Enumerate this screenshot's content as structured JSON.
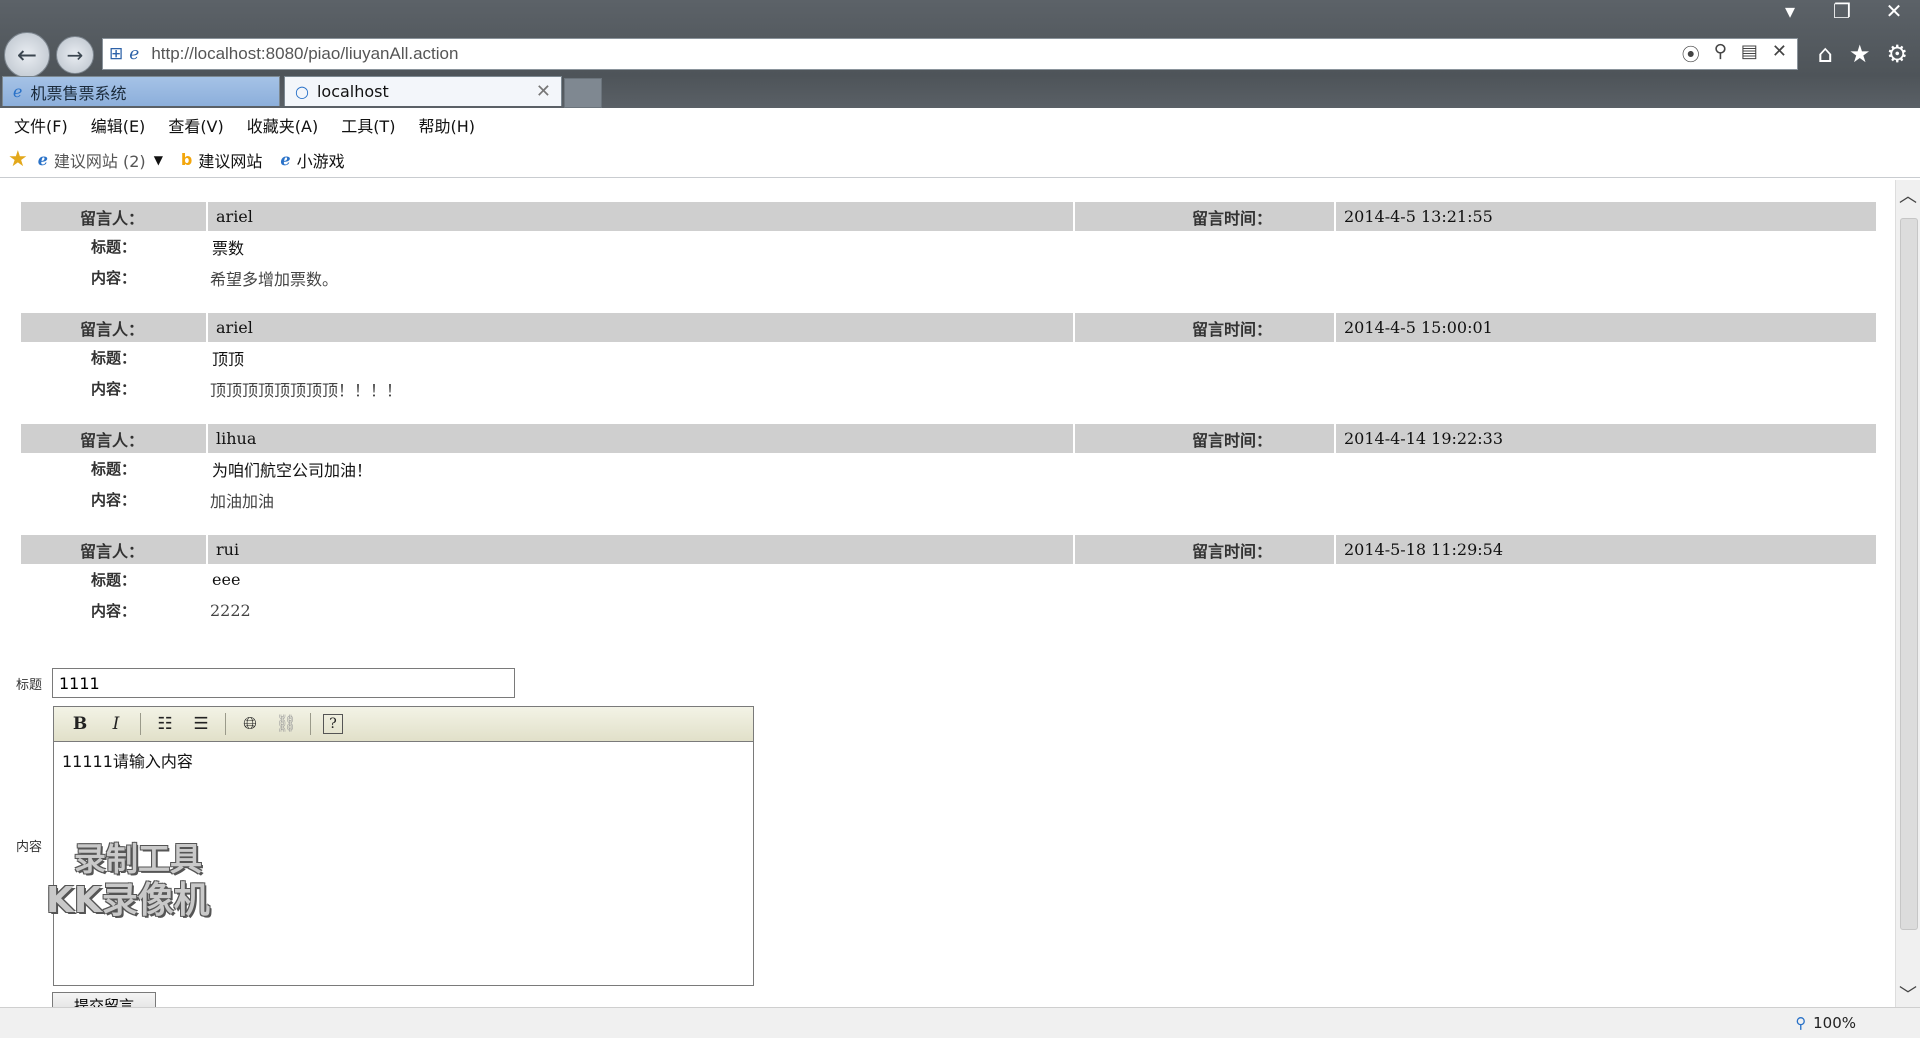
{
  "browser": {
    "address_url": "http://localhost:8080/piao/liuyanAll.action",
    "tabs": [
      {
        "label": "机票售票系统"
      },
      {
        "label": "localhost"
      }
    ],
    "menu": [
      "文件(F)",
      "编辑(E)",
      "查看(V)",
      "收藏夹(A)",
      "工具(T)",
      "帮助(H)"
    ],
    "favorites": [
      {
        "label": "建议网站 (2)"
      },
      {
        "label": "建议网站"
      },
      {
        "label": "小游戏"
      }
    ],
    "zoom": "100%",
    "accent_color": "#2a72c8"
  },
  "labels": {
    "author": "留言人：",
    "time": "留言时间：",
    "title": "标题：",
    "content": "内容："
  },
  "messages": [
    {
      "author": "ariel",
      "time": "2014-4-5 13:21:55",
      "title": "票数",
      "content": "希望多增加票数。"
    },
    {
      "author": "ariel",
      "time": "2014-4-5 15:00:01",
      "title": "顶顶",
      "content": "顶顶顶顶顶顶顶顶！！！！"
    },
    {
      "author": "lihua",
      "time": "2014-4-14 19:22:33",
      "title": "为咱们航空公司加油！",
      "content": "加油加油"
    },
    {
      "author": "rui",
      "time": "2014-5-18 11:29:54",
      "title": "eee",
      "content": "2222"
    }
  ],
  "form": {
    "title_label": "标题",
    "title_value": "1111",
    "content_label": "内容",
    "editor_text": "11111请输入内容",
    "submit_label": "提交留言"
  },
  "watermark": {
    "line1": "录制工具",
    "line2": "KK录像机"
  }
}
